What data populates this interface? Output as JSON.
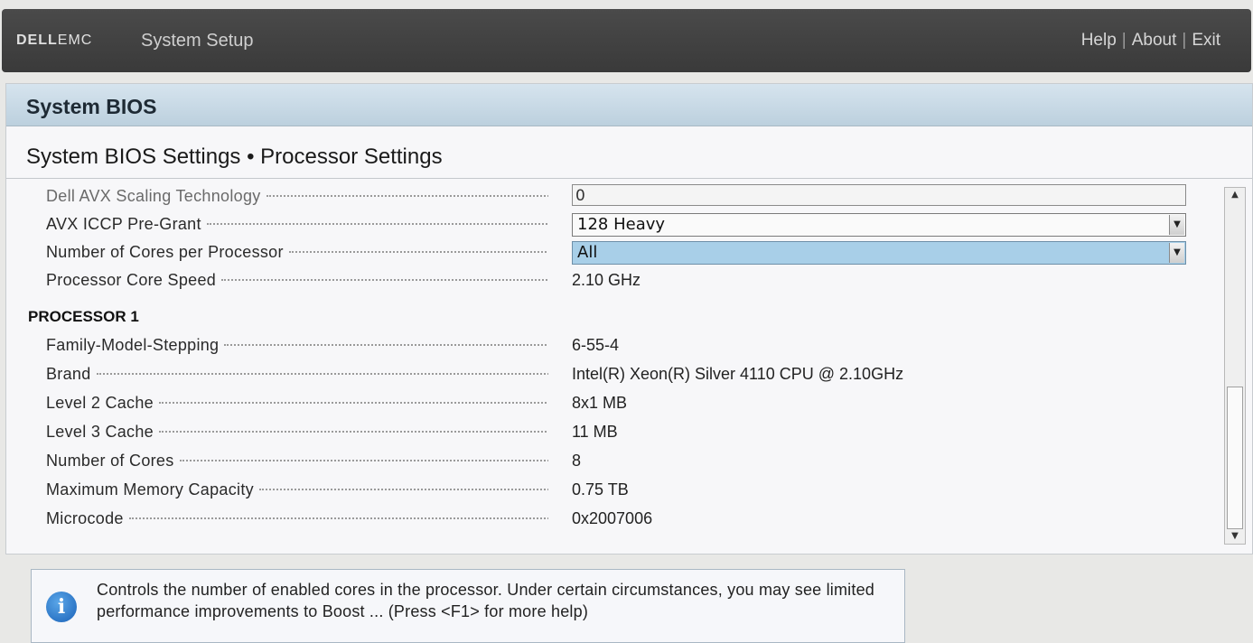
{
  "topbar": {
    "logo_main": "DELL",
    "logo_sub": "EMC",
    "app_title": "System Setup",
    "links": {
      "help": "Help",
      "about": "About",
      "exit": "Exit"
    },
    "separator": "|"
  },
  "panel": {
    "header": "System BIOS",
    "page_title": "System BIOS Settings • Processor Settings"
  },
  "settings": {
    "avx_scaling": {
      "label": "Dell AVX Scaling Technology",
      "value": "0"
    },
    "avx_iccp": {
      "label": "AVX ICCP Pre-Grant",
      "value": "128 Heavy"
    },
    "cores_per_proc": {
      "label": "Number of Cores per Processor",
      "value": "All"
    },
    "core_speed": {
      "label": "Processor Core Speed",
      "value": "2.10 GHz"
    }
  },
  "processor1": {
    "header": "PROCESSOR 1",
    "rows": [
      {
        "label": "Family-Model-Stepping",
        "value": "6-55-4"
      },
      {
        "label": "Brand",
        "value": "Intel(R) Xeon(R) Silver 4110 CPU @ 2.10GHz"
      },
      {
        "label": "Level 2 Cache",
        "value": "8x1 MB"
      },
      {
        "label": "Level 3 Cache",
        "value": "11 MB"
      },
      {
        "label": "Number of Cores",
        "value": "8"
      },
      {
        "label": "Maximum Memory Capacity",
        "value": "0.75 TB"
      },
      {
        "label": "Microcode",
        "value": "0x2007006"
      }
    ]
  },
  "help": {
    "icon": "info-icon",
    "text": "Controls the number of enabled cores in the processor. Under certain circumstances, you may see limited performance improvements to Boost ... (Press <F1> for more help)"
  },
  "icons": {
    "dropdown": "chevron-down-icon",
    "scroll_up": "arrow-up-icon",
    "scroll_down": "arrow-down-icon"
  },
  "colors": {
    "topbar": "#3f3f3f",
    "header_band": "#c8d9e5",
    "selected_field": "#a8cfe8",
    "info_icon": "#1a62b8"
  }
}
